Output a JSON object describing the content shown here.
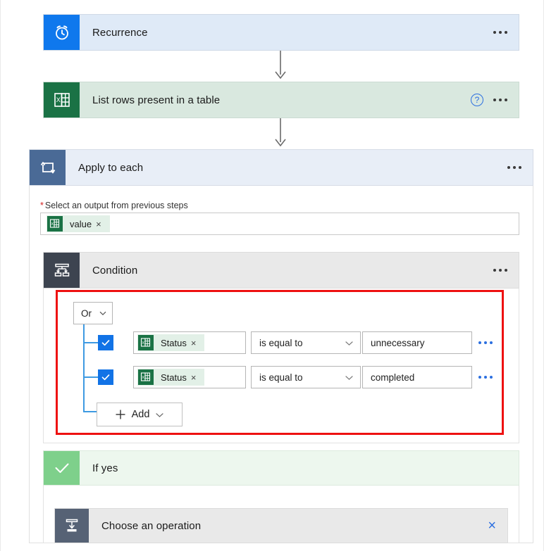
{
  "flow": {
    "recurrence": {
      "title": "Recurrence",
      "icon": "alarm-clock-icon",
      "accent": "#0f78ed",
      "card_bg": "#dfeaf7",
      "menu": "more-options"
    },
    "list_rows": {
      "title": "List rows present in a table",
      "icon": "excel-icon",
      "accent": "#1a7245",
      "card_bg": "#d9e8df",
      "help": "?",
      "menu": "more-options"
    },
    "apply_to_each": {
      "title": "Apply to each",
      "icon": "loop-icon",
      "accent": "#4a6a96",
      "card_bg": "#e8eef7",
      "menu": "more-options",
      "field": {
        "required_mark": "*",
        "label": "Select an output from previous steps",
        "token": {
          "label": "value",
          "remove": "×",
          "icon": "excel-icon"
        }
      }
    },
    "condition": {
      "title": "Condition",
      "icon": "condition-branch-icon",
      "accent": "#3d4450",
      "card_bg": "#e9e9e9",
      "menu": "more-options",
      "highlight_color": "#ee1111",
      "logic_operator": {
        "value": "Or",
        "chevron": "chevron-down-icon"
      },
      "rows": [
        {
          "checked": true,
          "token": {
            "label": "Status",
            "remove": "×",
            "icon": "excel-icon"
          },
          "operator": "is equal to",
          "value": "unnecessary",
          "menu": "more-options"
        },
        {
          "checked": true,
          "token": {
            "label": "Status",
            "remove": "×",
            "icon": "excel-icon"
          },
          "operator": "is equal to",
          "value": "completed",
          "menu": "more-options"
        }
      ],
      "add_button": {
        "label": "Add",
        "plus": "+",
        "chevron": "chevron-down-icon"
      }
    },
    "if_yes": {
      "title": "If yes",
      "icon": "checkmark-icon",
      "accent": "#7ed08b",
      "card_bg": "#edf7ee"
    },
    "choose_operation": {
      "title": "Choose an operation",
      "icon": "insert-step-icon",
      "accent": "#566275",
      "card_bg": "#e9e9e9",
      "close": "×"
    }
  }
}
